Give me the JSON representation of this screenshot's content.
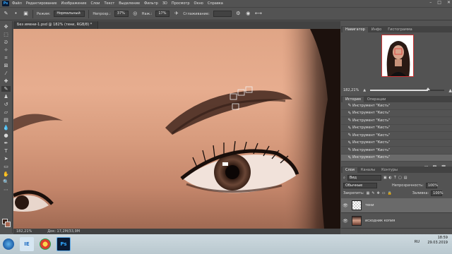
{
  "menubar": {
    "items": [
      "Файл",
      "Редактирование",
      "Изображение",
      "Слои",
      "Текст",
      "Выделение",
      "Фильтр",
      "3D",
      "Просмотр",
      "Окно",
      "Справка"
    ]
  },
  "options": {
    "mode_label": "Режим:",
    "mode_value": "Нормальный",
    "opacity_label": "Непрозр.:",
    "opacity_value": "37%",
    "flow_label": "Наж.:",
    "flow_value": "17%",
    "smoothing_label": "Сглаживание:"
  },
  "document": {
    "tab_title": "Без имени-1.psd @ 182% (тени, RGB/8) *"
  },
  "status": {
    "zoom": "182,21%",
    "doc_size": "Док: 17,2M/33,9M"
  },
  "navigator": {
    "tabs": [
      "Навигатор",
      "Инфо",
      "Гистограмма"
    ],
    "zoom_text": "182,21%",
    "zoom_fraction": 0.78
  },
  "history": {
    "tabs": [
      "История",
      "Операции"
    ],
    "rows": [
      "Инструмент \"Кисть\"",
      "Инструмент \"Кисть\"",
      "Инструмент \"Кисть\"",
      "Инструмент \"Кисть\"",
      "Инструмент \"Кисть\"",
      "Инструмент \"Кисть\"",
      "Инструмент \"Кисть\"",
      "Инструмент \"Кисть\""
    ],
    "selected_index": 7
  },
  "layers": {
    "tabs": [
      "Слои",
      "Каналы",
      "Контуры"
    ],
    "filter_value": "Вид",
    "blend_mode": "Обычные",
    "opacity_label": "Непрозрачность:",
    "opacity_value": "100%",
    "lock_label": "Закрепить:",
    "fill_label": "Заливка:",
    "fill_value": "100%",
    "items": [
      {
        "name": "тени",
        "selected": true
      },
      {
        "name": "исходник копия",
        "selected": false
      }
    ]
  },
  "taskbar": {
    "apps": [
      "IE",
      "Chrome",
      "Ps"
    ],
    "lang": "RU",
    "time": "18:59",
    "date": "29.03.2019"
  },
  "colors": {
    "foreground": "#3a1f16",
    "background": "#a86650",
    "ps_blue": "#31a8ff"
  }
}
